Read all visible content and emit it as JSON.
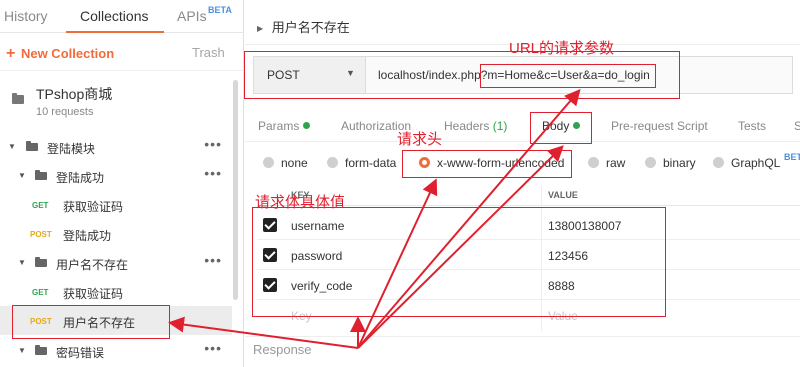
{
  "sidebar": {
    "tabs": [
      {
        "label": "History"
      },
      {
        "label": "Collections"
      },
      {
        "label": "APIs",
        "badge": "BETA"
      }
    ],
    "new_collection": "New Collection",
    "trash": "Trash",
    "collection": {
      "name": "TPshop商城",
      "count": "10 requests"
    },
    "tree": [
      {
        "label": "登陆模块"
      },
      {
        "label": "登陆成功"
      },
      {
        "method": "GET",
        "label": "获取验证码"
      },
      {
        "method": "POST",
        "label": "登陆成功"
      },
      {
        "label": "用户名不存在"
      },
      {
        "method": "GET",
        "label": "获取验证码"
      },
      {
        "method": "POST",
        "label": "用户名不存在"
      },
      {
        "label": "密码错误"
      }
    ]
  },
  "main": {
    "request_title": "用户名不存在",
    "method": "POST",
    "url": "localhost/index.php?m=Home&c=User&a=do_login",
    "tabs": [
      {
        "label": "Params"
      },
      {
        "label": "Authorization"
      },
      {
        "label": "Headers",
        "count": "(1)"
      },
      {
        "label": "Body"
      },
      {
        "label": "Pre-request Script"
      },
      {
        "label": "Tests"
      },
      {
        "label": "S"
      }
    ],
    "body_types": [
      {
        "label": "none"
      },
      {
        "label": "form-data"
      },
      {
        "label": "x-www-form-urlencoded"
      },
      {
        "label": "raw"
      },
      {
        "label": "binary"
      },
      {
        "label": "GraphQL",
        "badge": "BETA"
      }
    ],
    "table": {
      "headers": [
        "KEY",
        "VALUE"
      ],
      "rows": [
        {
          "key": "username",
          "value": "13800138007"
        },
        {
          "key": "password",
          "value": "123456"
        },
        {
          "key": "verify_code",
          "value": "8888"
        }
      ],
      "placeholder_key": "Key",
      "placeholder_value": "Value"
    },
    "response": "Response"
  },
  "annotations": {
    "url_params": "URL的请求参数",
    "header": "请求头",
    "body_values": "请求体具体值"
  },
  "colors": {
    "accent": "#f26b3a",
    "annotation": "#e0202e",
    "get": "#2ea44f",
    "post": "#e6a817"
  }
}
